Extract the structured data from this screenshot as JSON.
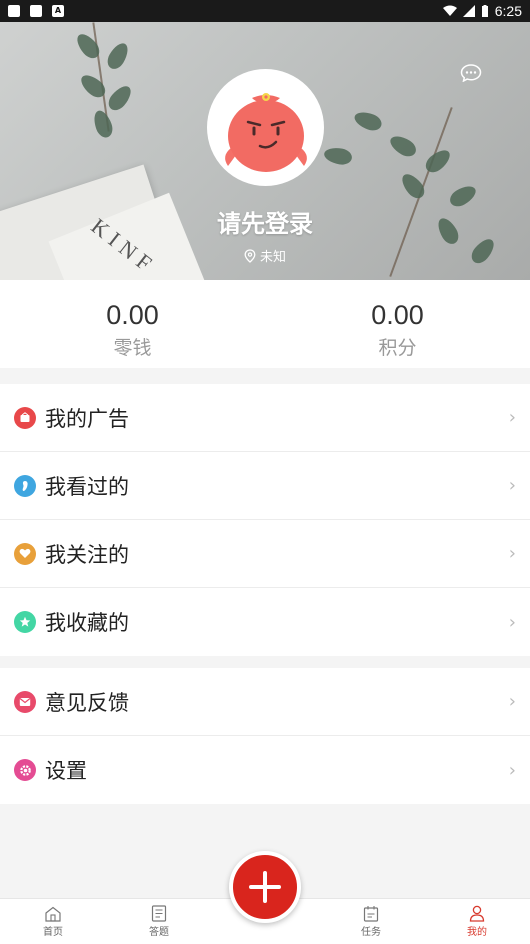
{
  "status_bar": {
    "time": "6:25"
  },
  "profile": {
    "username": "请先登录",
    "location": "未知"
  },
  "stats": [
    {
      "value": "0.00",
      "label": "零钱"
    },
    {
      "value": "0.00",
      "label": "积分"
    }
  ],
  "menu_group_1": [
    {
      "label": "我的广告",
      "icon": "ad-icon",
      "color": "#e8484a"
    },
    {
      "label": "我看过的",
      "icon": "footprint-icon",
      "color": "#3fa6e0"
    },
    {
      "label": "我关注的",
      "icon": "heart-icon",
      "color": "#e8a03a"
    },
    {
      "label": "我收藏的",
      "icon": "star-icon",
      "color": "#43d6a4"
    }
  ],
  "menu_group_2": [
    {
      "label": "意见反馈",
      "icon": "mail-icon",
      "color": "#e84a6a"
    },
    {
      "label": "设置",
      "icon": "gear-icon",
      "color": "#e44c93"
    }
  ],
  "tabs": [
    {
      "label": "首页",
      "icon": "home-icon"
    },
    {
      "label": "答题",
      "icon": "quiz-icon"
    },
    {
      "label": "任务",
      "icon": "task-icon"
    },
    {
      "label": "我的",
      "icon": "user-icon",
      "active": true
    }
  ],
  "colors": {
    "accent": "#d9251d",
    "active_tab": "#d83a2e"
  }
}
